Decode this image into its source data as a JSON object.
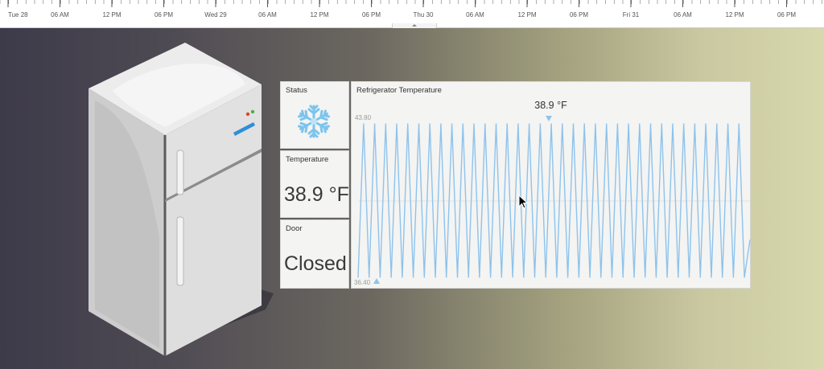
{
  "timeline": {
    "labels": [
      "Tue 28",
      "06 AM",
      "12 PM",
      "06 PM",
      "Wed 29",
      "06 AM",
      "12 PM",
      "06 PM",
      "Thu 30",
      "06 AM",
      "12 PM",
      "06 PM",
      "Fri 31",
      "06 AM",
      "12 PM",
      "06 PM"
    ]
  },
  "status_panel": {
    "title": "Status",
    "icon": "snowflake-icon"
  },
  "temperature_panel": {
    "title": "Temperature",
    "value": "38.9 °F"
  },
  "door_panel": {
    "title": "Door",
    "value": "Closed"
  },
  "chart_panel": {
    "title": "Refrigerator Temperature",
    "current_value": "38.9 °F",
    "y_max_label": "43.80",
    "y_min_label": "36.40"
  },
  "colors": {
    "line": "#8ec3ec",
    "panel_bg": "#f4f4f3",
    "bg_left": "#3d3a4a",
    "bg_right": "#d8d8ad"
  },
  "chart_data": {
    "type": "line",
    "title": "Refrigerator Temperature",
    "ylim": [
      36.4,
      43.8
    ],
    "grid": false,
    "series": [
      {
        "values": [
          36.4,
          43.8,
          36.4,
          43.8,
          36.4,
          43.8,
          36.4,
          43.8,
          36.4,
          43.8,
          36.4,
          43.8,
          36.4,
          43.8,
          36.4,
          43.8,
          36.4,
          43.8,
          36.4,
          43.8,
          36.4,
          43.8,
          36.4,
          43.8,
          36.4,
          43.8,
          36.4,
          43.8,
          36.4,
          43.8,
          36.4,
          43.8,
          36.4,
          43.8,
          36.4,
          43.8,
          36.4,
          43.8,
          36.4,
          43.8,
          36.4,
          43.8,
          36.4,
          43.8,
          36.4,
          43.8,
          36.4,
          43.8,
          36.4,
          43.8,
          36.4,
          43.8,
          36.4,
          43.8,
          36.4,
          43.8,
          36.4,
          43.8,
          36.4,
          43.8,
          36.4,
          43.8,
          36.4,
          43.8,
          36.4,
          43.8,
          36.4,
          43.8,
          36.4,
          43.8,
          36.4,
          38.2
        ]
      }
    ]
  }
}
